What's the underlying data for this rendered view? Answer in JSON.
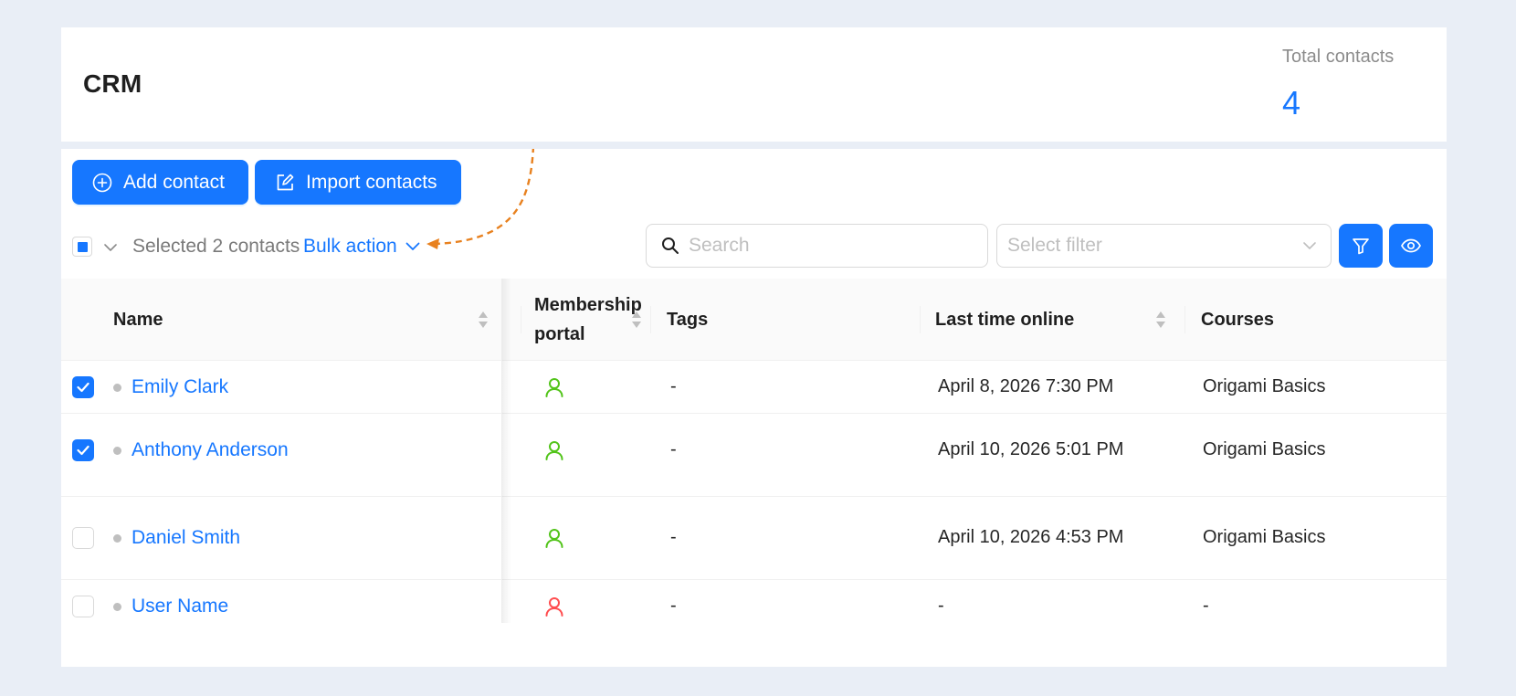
{
  "header": {
    "title": "CRM",
    "total_label": "Total contacts",
    "total_value": "4"
  },
  "toolbar": {
    "add_contact": "Add contact",
    "import_contacts": "Import contacts",
    "selected_text": "Selected 2 contacts",
    "bulk_action": "Bulk action",
    "search_placeholder": "Search",
    "filter_placeholder": "Select filter"
  },
  "table": {
    "columns": {
      "name": "Name",
      "membership": "Membership portal",
      "tags": "Tags",
      "last_online": "Last time online",
      "courses": "Courses"
    },
    "rows": [
      {
        "name": "Emily Clark",
        "checked": true,
        "membership_status": "active",
        "tags": "-",
        "last_online": "April 8, 2026 7:30 PM",
        "courses": "Origami Basics"
      },
      {
        "name": "Anthony Anderson",
        "checked": true,
        "membership_status": "active",
        "tags": "-",
        "last_online": "April 10, 2026 5:01 PM",
        "courses": "Origami Basics"
      },
      {
        "name": "Daniel Smith",
        "checked": false,
        "membership_status": "active",
        "tags": "-",
        "last_online": "April 10, 2026 4:53 PM",
        "courses": "Origami Basics"
      },
      {
        "name": "User Name",
        "checked": false,
        "membership_status": "inactive",
        "tags": "-",
        "last_online": "-",
        "courses": "-"
      }
    ]
  },
  "colors": {
    "primary": "#1677ff",
    "active_member": "#52c41a",
    "inactive_member": "#ff4d4f",
    "annotation_arrow": "#e8811f"
  },
  "icons": {
    "add": "plus-circle-icon",
    "import": "edit-square-icon",
    "search": "search-icon",
    "filter": "filter-icon",
    "view": "eye-icon",
    "member": "user-icon"
  }
}
